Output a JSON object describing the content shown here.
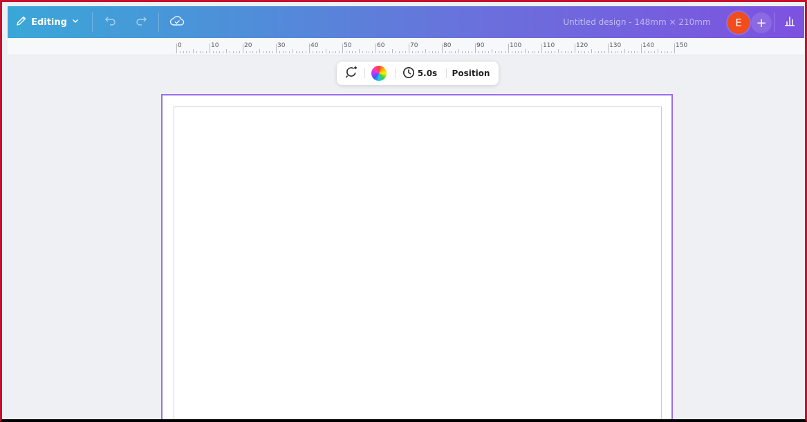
{
  "topbar": {
    "mode_label": "Editing",
    "design_title": "Untitled design - 148mm × 210mm",
    "avatar_initial": "E",
    "add_label": "+"
  },
  "ruler": {
    "labels": [
      "0",
      "10",
      "20",
      "30",
      "40",
      "50",
      "60",
      "70",
      "80",
      "90",
      "100",
      "110",
      "120",
      "130",
      "140",
      "150"
    ]
  },
  "toolbar": {
    "duration": "5.0s",
    "position_label": "Position"
  },
  "colors": {
    "topbar_start": "#3aa7d8",
    "topbar_end": "#7d52e0",
    "avatar": "#f24b1c",
    "page_selection": "#9a6cf0",
    "workspace": "#eef0f4"
  },
  "icons": {
    "mode": "pencil-icon",
    "mode_menu": "chevron-down-icon",
    "undo": "undo-icon",
    "redo": "redo-icon",
    "save_status": "cloud-check-icon",
    "insights": "bar-chart-icon",
    "animate": "animate-icon",
    "color": "color-wheel-icon",
    "duration": "clock-icon"
  }
}
